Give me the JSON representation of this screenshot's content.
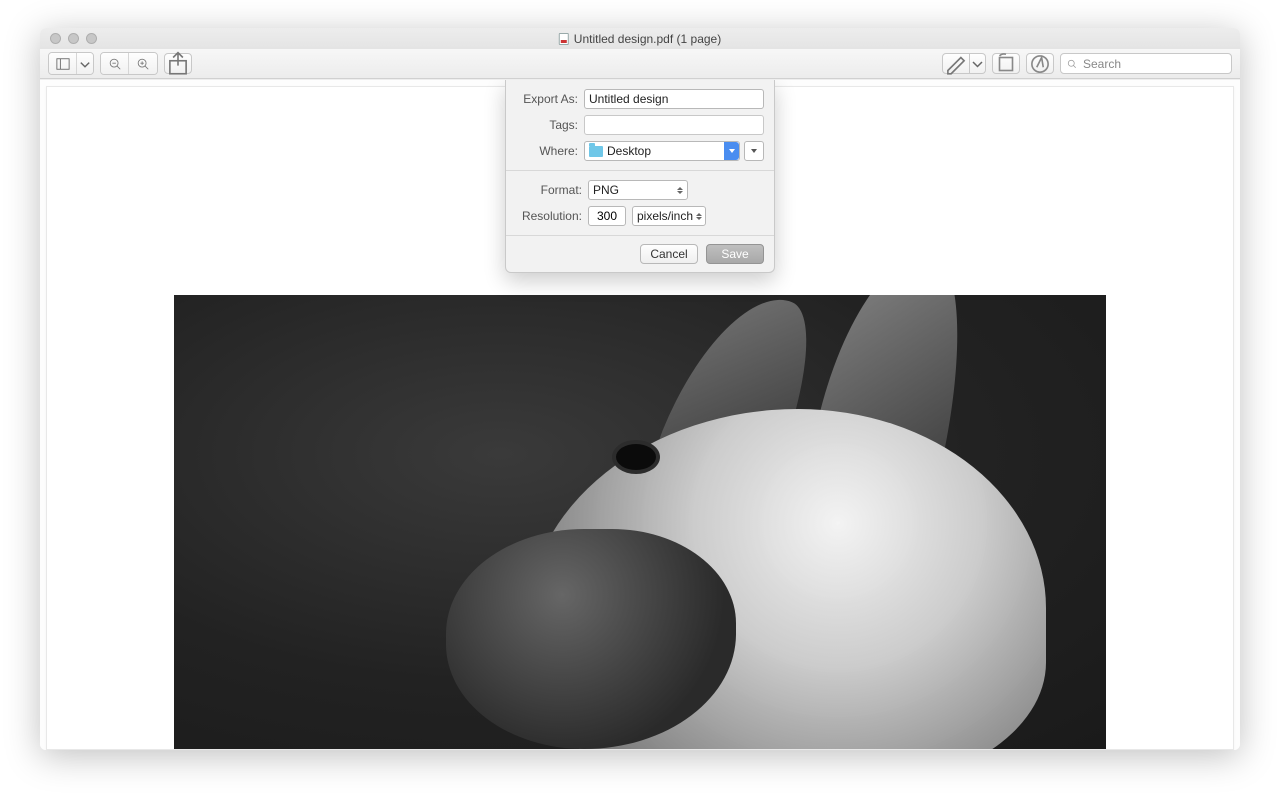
{
  "window": {
    "title": "Untitled design.pdf (1 page)"
  },
  "toolbar": {
    "search_placeholder": "Search"
  },
  "export": {
    "export_as_label": "Export As:",
    "export_as_value": "Untitled design",
    "tags_label": "Tags:",
    "tags_value": "",
    "where_label": "Where:",
    "where_value": "Desktop",
    "format_label": "Format:",
    "format_value": "PNG",
    "resolution_label": "Resolution:",
    "resolution_value": "300",
    "resolution_unit": "pixels/inch",
    "cancel": "Cancel",
    "save": "Save"
  }
}
